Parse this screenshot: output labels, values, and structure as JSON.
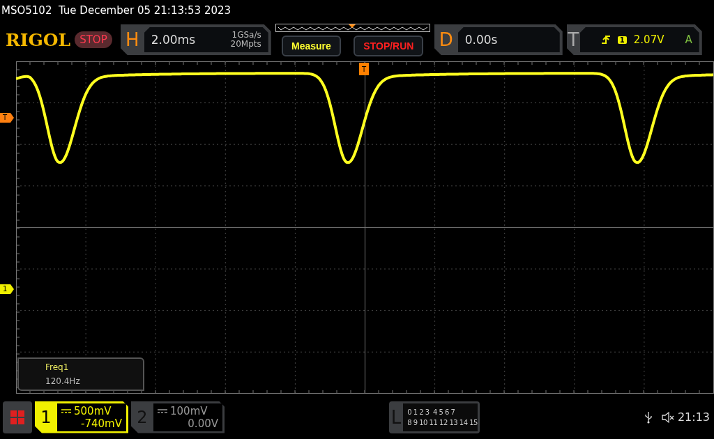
{
  "title": "MSO5102  Tue December 05 21:13:53 2023",
  "logo": "RIGOL",
  "run_state": "STOP",
  "horizontal": {
    "label": "H",
    "timebase": "2.00ms",
    "sample_rate": "1GSa/s",
    "memory_depth": "20Mpts"
  },
  "buttons": [
    {
      "label": "Measure",
      "kind": "measure"
    },
    {
      "label": "STOP/RUN",
      "kind": "stoprun"
    }
  ],
  "delay": {
    "label": "D",
    "value": "0.00s"
  },
  "trigger": {
    "label": "T",
    "source": "1",
    "level": "2.07V",
    "mode": "A"
  },
  "markers": {
    "trigger_level": "T",
    "channel": "1",
    "trigger_position": "T"
  },
  "measurement": {
    "name": "Freq1",
    "value": "120.4Hz"
  },
  "channels": [
    {
      "number": "1",
      "scale": "500mV",
      "offset": "-740mV",
      "selected": true
    },
    {
      "number": "2",
      "scale": "100mV",
      "offset": "0.00V",
      "selected": false
    }
  ],
  "logic": {
    "label": "L",
    "row_1": "0 1 2 3  4 5 6 7",
    "row_2": "8 9 10 11 12 13 14 15"
  },
  "clock": "21:13"
}
